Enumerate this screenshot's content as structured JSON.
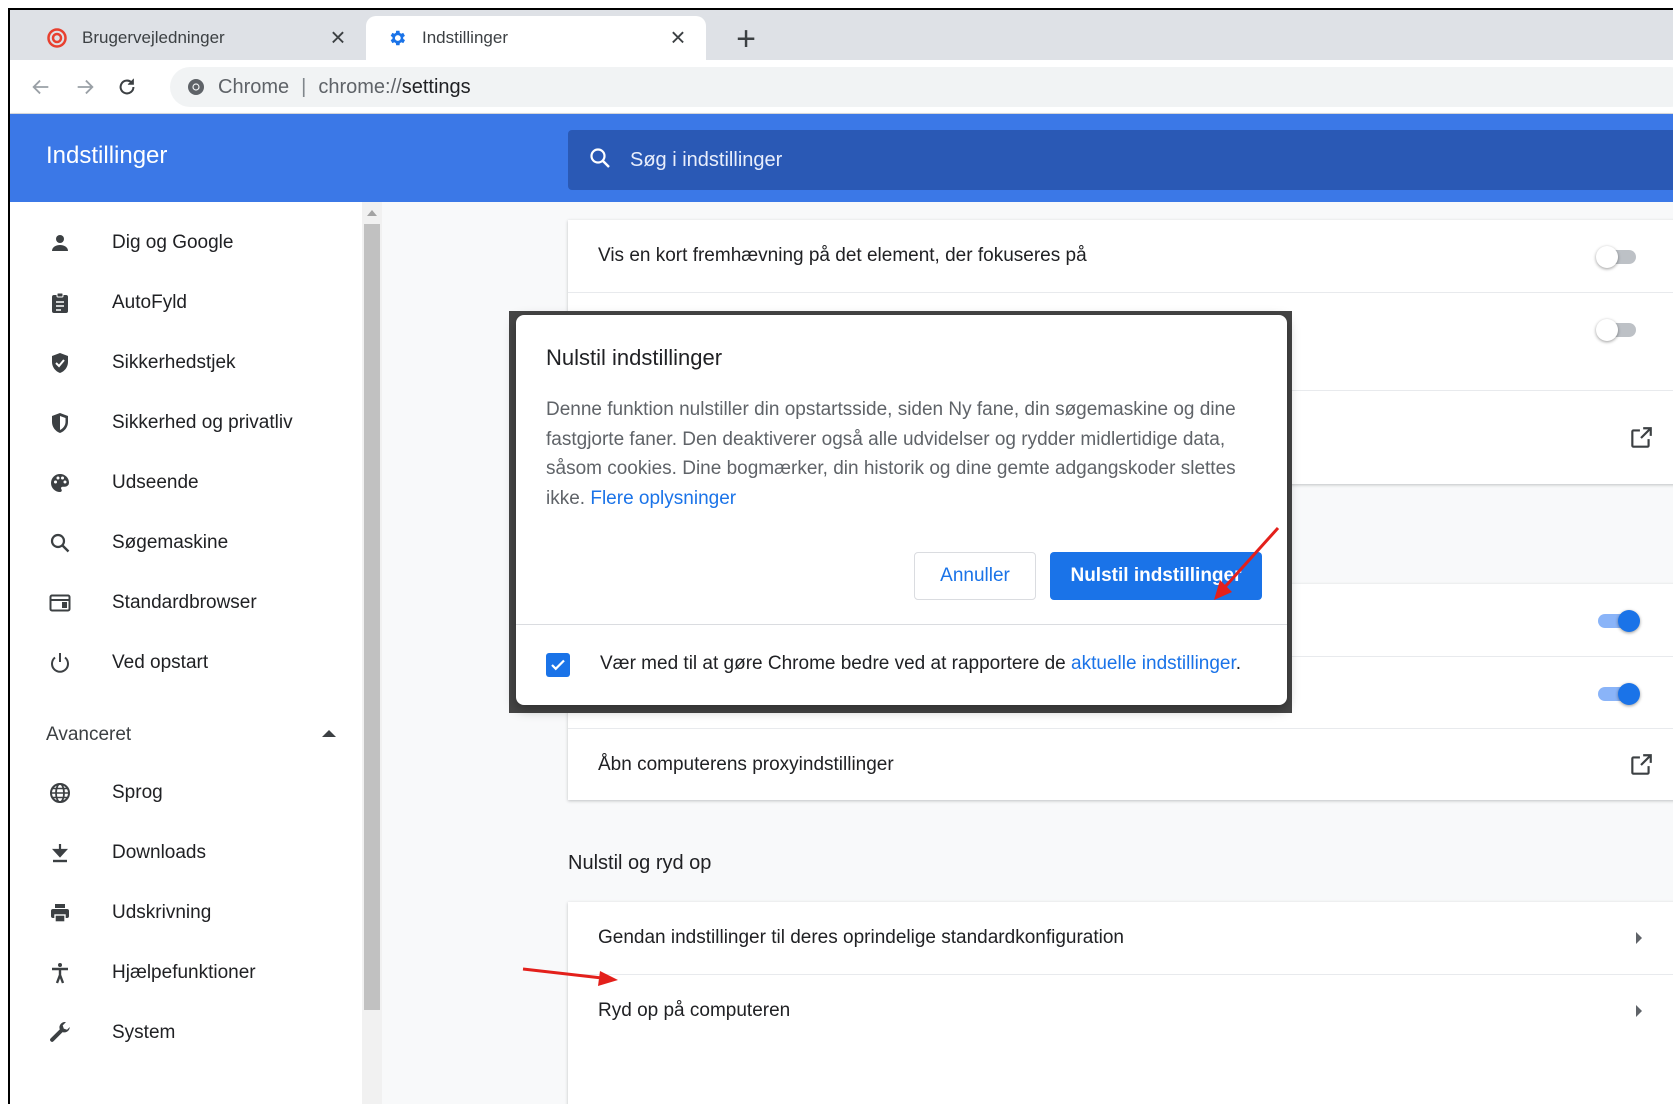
{
  "colors": {
    "accent": "#1a73e8",
    "header_blue": "#3b78e7",
    "search_bar_blue": "#2a59b5",
    "annotation_red": "#e3201b"
  },
  "tabs": [
    {
      "title": "Brugervejledninger",
      "icon": "brand-logo-icon",
      "close": "×"
    },
    {
      "title": "Indstillinger",
      "icon": "settings-gear-icon",
      "close": "×"
    }
  ],
  "new_tab": "+",
  "omnibox": {
    "site_label": "Chrome",
    "separator": "|",
    "url_scheme": "chrome://",
    "url_path": "settings"
  },
  "header": {
    "title": "Indstillinger",
    "search_placeholder": "Søg i indstillinger"
  },
  "sidebar": {
    "items": [
      {
        "label": "Dig og Google",
        "icon": "person-icon"
      },
      {
        "label": "AutoFyld",
        "icon": "clipboard-icon"
      },
      {
        "label": "Sikkerhedstjek",
        "icon": "shield-check-icon"
      },
      {
        "label": "Sikkerhed og privatliv",
        "icon": "shield-half-icon"
      },
      {
        "label": "Udseende",
        "icon": "palette-icon"
      },
      {
        "label": "Søgemaskine",
        "icon": "search-icon"
      },
      {
        "label": "Standardbrowser",
        "icon": "browser-window-icon"
      },
      {
        "label": "Ved opstart",
        "icon": "power-icon"
      }
    ],
    "advanced_label": "Avanceret",
    "advanced_items": [
      {
        "label": "Sprog",
        "icon": "globe-icon"
      },
      {
        "label": "Downloads",
        "icon": "download-icon"
      },
      {
        "label": "Udskrivning",
        "icon": "printer-icon"
      },
      {
        "label": "Hjælpefunktioner",
        "icon": "accessibility-icon"
      },
      {
        "label": "System",
        "icon": "wrench-icon"
      }
    ]
  },
  "main": {
    "rows_top": [
      {
        "label": "Vis en kort fremhævning på det element, der fokuseres på",
        "control": "toggle",
        "on": false
      }
    ],
    "system_rows": [
      {
        "label": "Åbn computerens proxyindstillinger",
        "control": "external-link"
      }
    ],
    "reset_section_title": "Nulstil og ryd op",
    "reset_rows": [
      {
        "label": "Gendan indstillinger til deres oprindelige standardkonfiguration",
        "control": "chevron"
      },
      {
        "label": "Ryd op på computeren",
        "control": "chevron"
      }
    ]
  },
  "dialog": {
    "title": "Nulstil indstillinger",
    "body": "Denne funktion nulstiller din opstartsside, siden Ny fane, din søgemaskine og dine fastgjorte faner. Den deaktiverer også alle udvidelser og rydder midlertidige data, såsom cookies. Dine bogmærker, din historik og dine gemte adgangskoder slettes ikke.",
    "learn_more": "Flere oplysninger",
    "cancel_label": "Annuller",
    "confirm_label": "Nulstil indstillinger",
    "report_text": "Vær med til at gøre Chrome bedre ved at rapportere de",
    "report_link": "aktuelle indstillinger",
    "report_end": ".",
    "report_checked": true
  }
}
